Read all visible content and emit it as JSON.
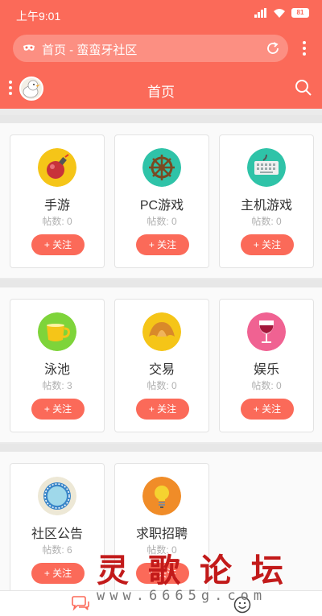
{
  "status": {
    "time": "上午9:01",
    "battery": "81"
  },
  "browser": {
    "url_title": "首页 - 蛮蛮牙社区"
  },
  "nav": {
    "title": "首页"
  },
  "cards": [
    {
      "name": "手游",
      "count": "帖数: 0",
      "follow": "+ 关注",
      "icon": "bomb-icon",
      "color": "#f5c518"
    },
    {
      "name": "PC游戏",
      "count": "帖数: 0",
      "follow": "+ 关注",
      "icon": "ship-wheel-icon",
      "color": "#2fc3a8"
    },
    {
      "name": "主机游戏",
      "count": "帖数: 0",
      "follow": "+ 关注",
      "icon": "keyboard-icon",
      "color": "#2fc3a8"
    },
    {
      "name": "泳池",
      "count": "帖数: 3",
      "follow": "+ 关注",
      "icon": "coffee-cup-icon",
      "color": "#7ed43a"
    },
    {
      "name": "交易",
      "count": "帖数: 0",
      "follow": "+ 关注",
      "icon": "croissant-icon",
      "color": "#f5c518"
    },
    {
      "name": "娱乐",
      "count": "帖数: 0",
      "follow": "+ 关注",
      "icon": "wine-glass-icon",
      "color": "#f06292"
    },
    {
      "name": "社区公告",
      "count": "帖数: 6",
      "follow": "+ 关注",
      "icon": "plate-icon",
      "color": "#ede8d6"
    },
    {
      "name": "求职招聘",
      "count": "帖数: 0",
      "follow": "+ 关注",
      "icon": "light-bulb-icon",
      "color": "#f08c28"
    }
  ],
  "watermark": {
    "title": "灵歌论坛",
    "url": "www.6665g.com"
  }
}
